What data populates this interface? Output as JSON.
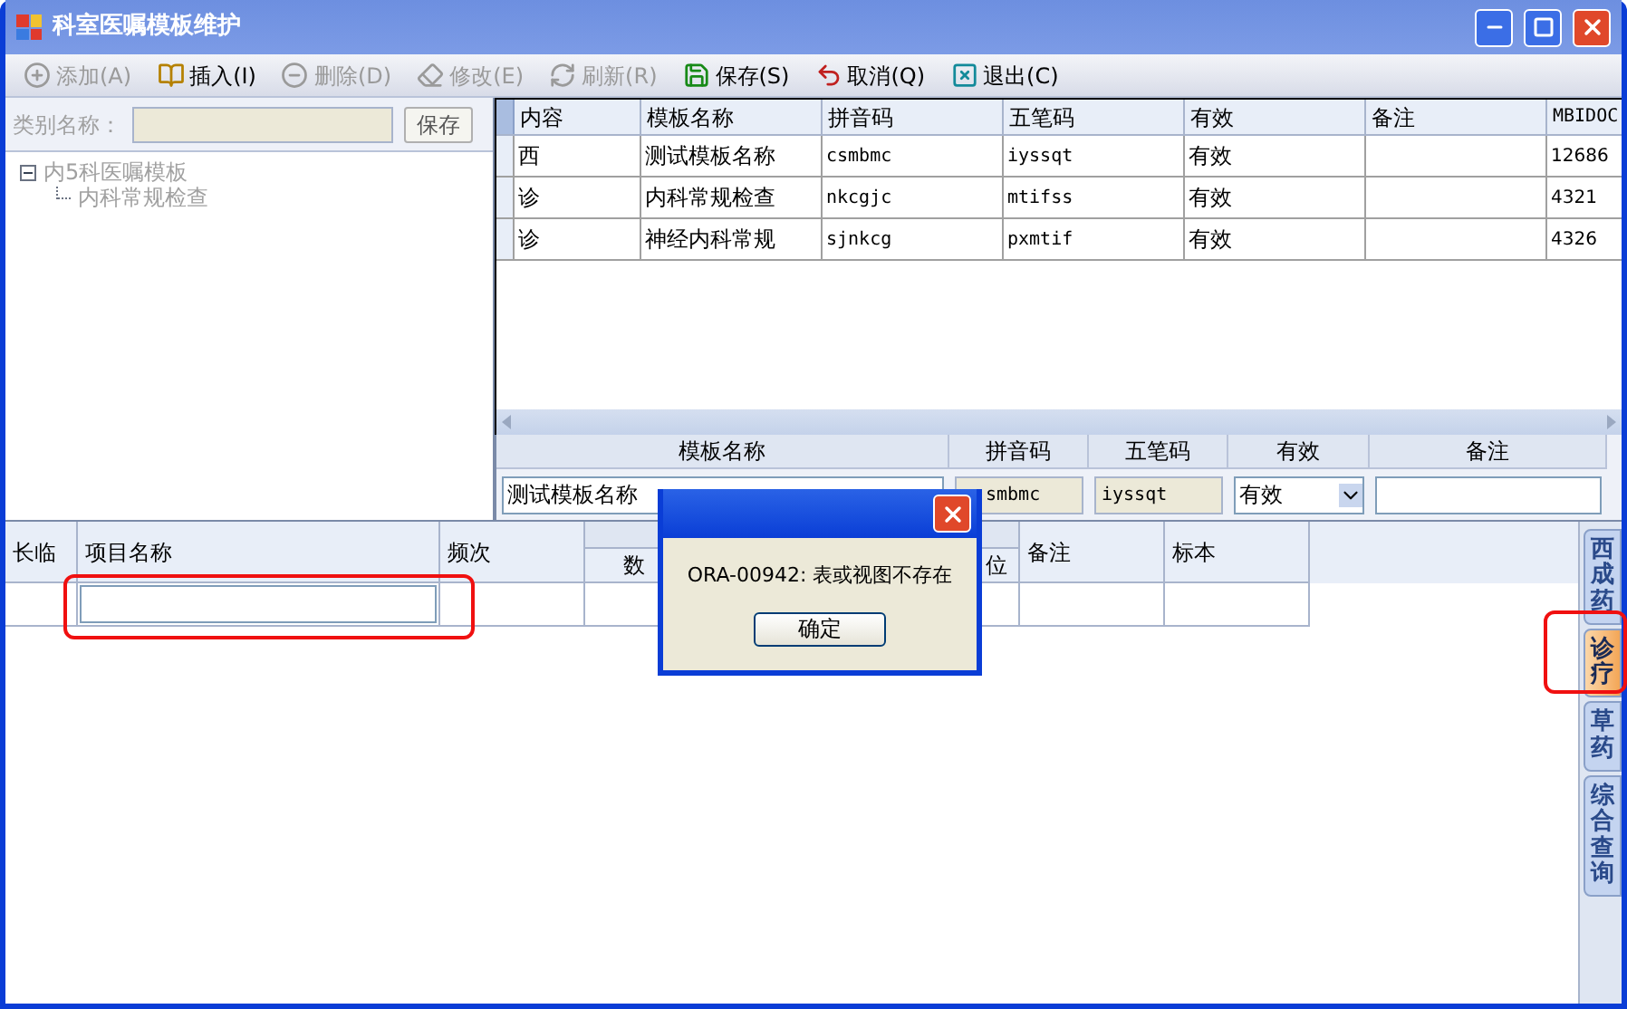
{
  "window": {
    "title": "科室医嘱模板维护"
  },
  "toolbar": [
    {
      "kind": "add",
      "label": "添加(A)",
      "disabled": true
    },
    {
      "kind": "insert",
      "label": "插入(I)",
      "disabled": false
    },
    {
      "kind": "delete",
      "label": "删除(D)",
      "disabled": true
    },
    {
      "kind": "edit",
      "label": "修改(E)",
      "disabled": true
    },
    {
      "kind": "refresh",
      "label": "刷新(R)",
      "disabled": true
    },
    {
      "kind": "save",
      "label": "保存(S)",
      "disabled": false
    },
    {
      "kind": "cancel",
      "label": "取消(Q)",
      "disabled": false
    },
    {
      "kind": "exit",
      "label": "退出(C)",
      "disabled": false
    }
  ],
  "category": {
    "label": "类别名称：",
    "save_button": "保存"
  },
  "tree": [
    {
      "label": "内5科医嘱模板",
      "expanded": true,
      "children": [
        {
          "label": "内科常规检查"
        }
      ]
    }
  ],
  "template_table": {
    "columns": [
      "内容",
      "模板名称",
      "拼音码",
      "五笔码",
      "有效",
      "备注",
      "MBIDOC"
    ],
    "rows": [
      [
        "西",
        "测试模板名称",
        "csmbmc",
        "iyssqt",
        "有效",
        "",
        "12686"
      ],
      [
        "诊",
        "内科常规检查",
        "nkcgjc",
        "mtifss",
        "有效",
        "",
        "4321"
      ],
      [
        "诊",
        "神经内科常规",
        "sjnkcg",
        "pxmtif",
        "有效",
        "",
        "4326"
      ]
    ]
  },
  "edit_form": {
    "fields": [
      {
        "label": "模板名称",
        "value": "测试模板名称",
        "kind": "text"
      },
      {
        "label": "拼音码",
        "value": "smbmc",
        "kind": "readonly"
      },
      {
        "label": "五笔码",
        "value": "iyssqt",
        "kind": "readonly"
      },
      {
        "label": "有效",
        "value": "有效",
        "kind": "select"
      },
      {
        "label": "备注",
        "kind": "text"
      }
    ]
  },
  "item_table": {
    "columns": [
      "长临",
      "项目名称",
      "频次"
    ],
    "group_subcolumns": [
      "数",
      "位"
    ],
    "columns_after": [
      "备注",
      "标本"
    ]
  },
  "side_tabs": [
    {
      "label": "西成药",
      "selected": false
    },
    {
      "label": "诊疗",
      "selected": true
    },
    {
      "label": "草药",
      "selected": false
    },
    {
      "label": "综合查询",
      "selected": false
    }
  ],
  "dialog": {
    "message": "ORA-00942: 表或视图不存在",
    "ok_button": "确定"
  }
}
